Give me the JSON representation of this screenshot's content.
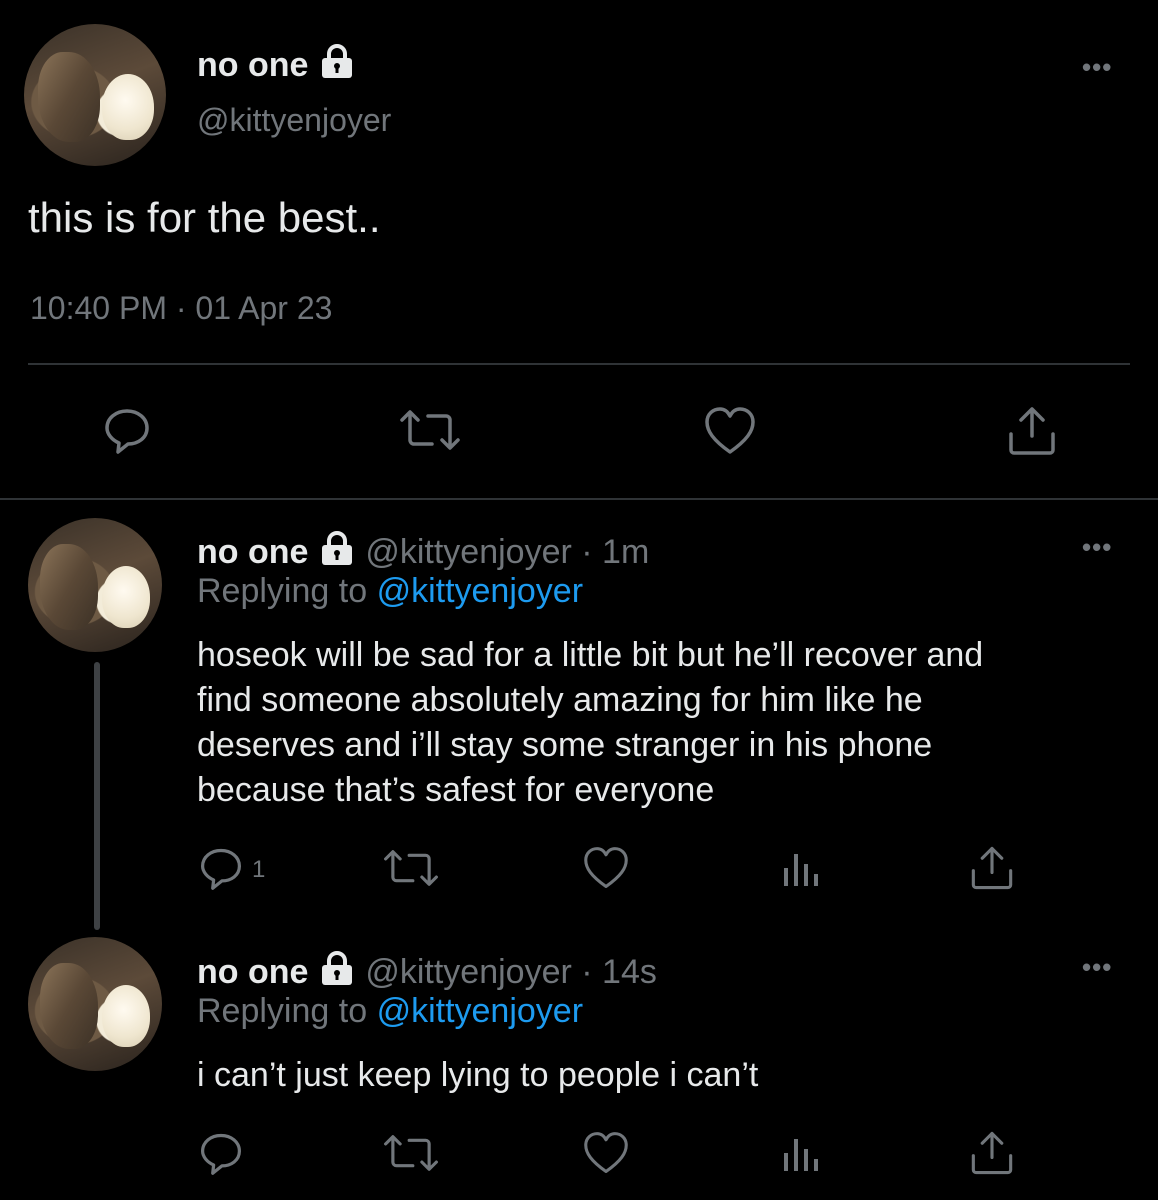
{
  "main_tweet": {
    "display_name": "no one",
    "handle": "@kittyenjoyer",
    "text": "this is for the best..",
    "timestamp": "10:40 PM · 01 Apr 23",
    "more_label": "•••"
  },
  "replies": [
    {
      "display_name": "no one",
      "handle_time": "@kittyenjoyer · 1m",
      "replying_prefix": "Replying to",
      "replying_to": "@kittyenjoyer",
      "text_lines": [
        "hoseok will be sad for a little bit but he’ll recover and",
        "find someone absolutely amazing for him like he",
        "deserves and i’ll stay some stranger in his phone",
        "because that’s safest for everyone"
      ],
      "reply_count": "1",
      "more_label": "•••"
    },
    {
      "display_name": "no one",
      "handle_time": "@kittyenjoyer · 14s",
      "replying_prefix": "Replying to",
      "replying_to": "@kittyenjoyer",
      "text_lines": [
        "i can’t just keep lying to people i can’t"
      ],
      "more_label": "•••"
    }
  ],
  "icons": {
    "reply": "speech-bubble-icon",
    "retweet": "retweet-icon",
    "like": "heart-icon",
    "views": "bar-chart-icon",
    "share": "share-icon",
    "lock": "padlock-icon"
  },
  "colors": {
    "background": "#000000",
    "text": "#e7e9ea",
    "muted": "#71767b",
    "link": "#1d9bf0",
    "divider": "#2f3336"
  }
}
